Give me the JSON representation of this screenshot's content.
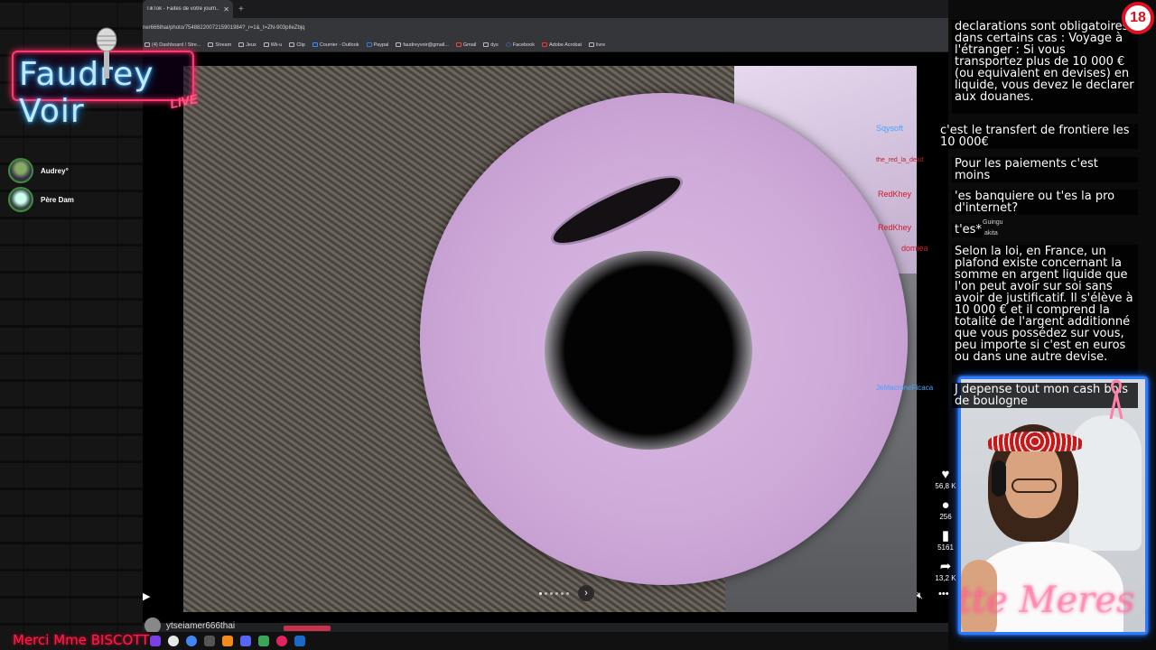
{
  "overlay": {
    "logo_text": "Faudrey Voir",
    "logo_live": "LIVE",
    "viewers": [
      {
        "name": "Audrey°"
      },
      {
        "name": "Père Dam"
      }
    ],
    "bottom_ticker": "Merci Mme BISCOTT",
    "badge_18": "18",
    "cam_overlay_text": "tte Meres Et P",
    "accent_color": "#ff3a6e",
    "cam_border_color": "#2a7cff"
  },
  "browser": {
    "tabs": [
      {
        "title": "TikTok - Faites de votre journ..."
      }
    ],
    "newtab_symbol": "+",
    "url": "ner666thai/photo/7548822007215901984?_r=1&_t=ZN-903pIleZbjq",
    "bookmarks": [
      {
        "label": "(4) Dashboard / Stre..."
      },
      {
        "label": "Stream"
      },
      {
        "label": "Jeux"
      },
      {
        "label": "Wii-u"
      },
      {
        "label": "Clip"
      },
      {
        "label": "Courrier - Outlook"
      },
      {
        "label": "Paypal"
      },
      {
        "label": "faudreyvoir@gmail..."
      },
      {
        "label": "Gmail"
      },
      {
        "label": "dys"
      },
      {
        "label": "Facebook"
      },
      {
        "label": "Adobe Acrobat"
      },
      {
        "label": "livre"
      }
    ]
  },
  "post": {
    "username": "ytseiamer666thai",
    "likes": "56,8 K",
    "comments": "256",
    "saves": "5161",
    "shares": "13,2 K",
    "page_dots": 6,
    "active_dot": 0,
    "icons": {
      "play": "play-icon",
      "prev": "chevron-left-icon",
      "next": "chevron-right-icon",
      "like": "heart-icon",
      "comment": "comment-icon",
      "save": "bookmark-icon",
      "share": "share-icon",
      "mute": "mute-icon",
      "more": "more-icon"
    }
  },
  "chat": {
    "messages": [
      {
        "text": "declarations sont obligatoires dans certains cas : Voyage à l'étranger : Si vous transportez plus de 10 000 € (ou equivalent en devises) en liquide, vous devez le declarer aux douanes."
      },
      {
        "user": "Sqysoft",
        "text": "c'est le transfert de frontiere les 10 000€"
      },
      {
        "user": "the_red_la_dead",
        "text": "Pour les paiements c'est moins"
      },
      {
        "user": "RedKhey",
        "text": "'es banquiere ou t'es la pro d'internet?"
      },
      {
        "user": "RedKhey",
        "text": "t'es*"
      },
      {
        "user": "domiea",
        "text": "Selon la loi, en France, un plafond existe concernant la somme en argent liquide que l'on peut avoir sur soi sans avoir de justificatif. Il s'élève à 10 000 € et il comprend la totalité de l'argent additionné que vous possédez sur vous, peu importe si c'est en euros ou dans une autre devise."
      },
      {
        "user": "JeMacroneFicaca",
        "text": "J depense tout mon cash bois de boulogne"
      }
    ],
    "overlap_names": [
      "Guingu",
      "akita"
    ]
  }
}
